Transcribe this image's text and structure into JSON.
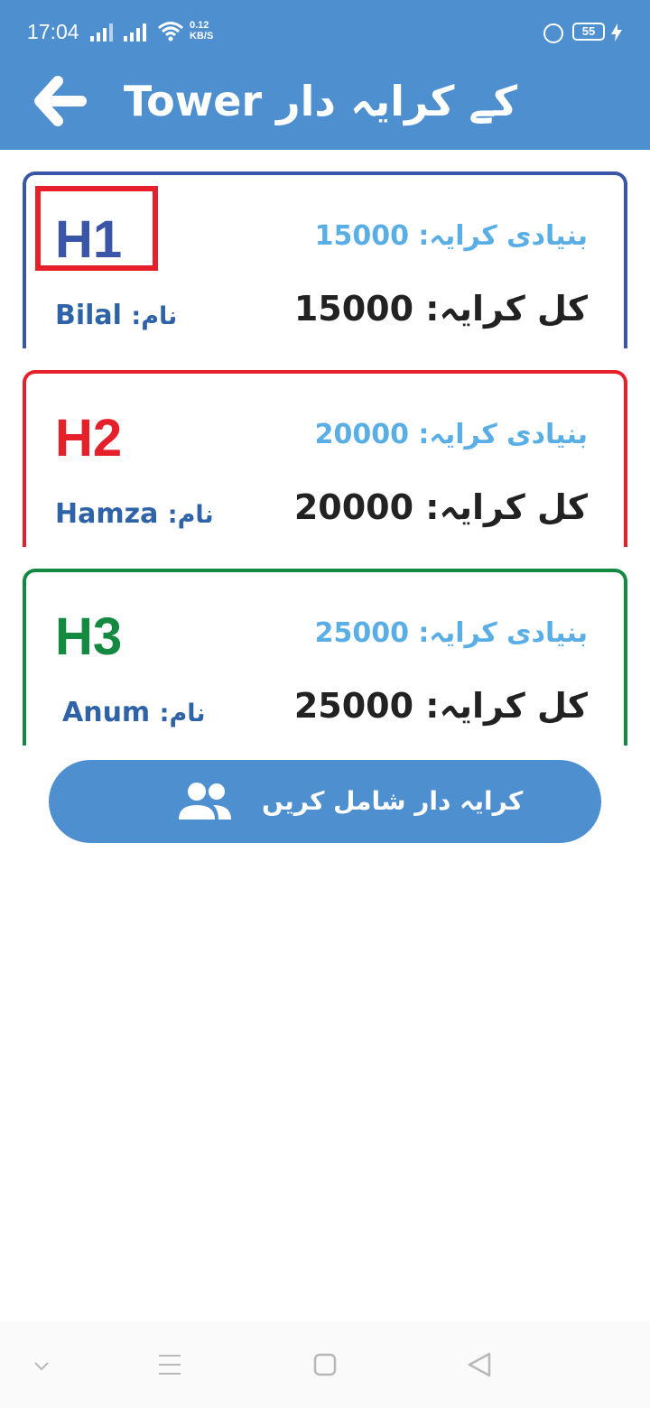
{
  "status_bar": {
    "time": "17:04",
    "net_speed_value": "0.12",
    "net_speed_unit": "KB/S",
    "battery": "55"
  },
  "header": {
    "title": "Tower کے کرایہ دار",
    "back_icon": "arrow-left-icon",
    "background_color": "#4e8fd0"
  },
  "labels": {
    "base_rent": "بنیادی کرایہ:",
    "total_rent": "کل کرایہ:",
    "name": "نام:"
  },
  "tenants": [
    {
      "code": "H1",
      "base_rent": "15000",
      "total_rent": "15000",
      "name": "Bilal",
      "color": "#3a54a8"
    },
    {
      "code": "H2",
      "base_rent": "20000",
      "total_rent": "20000",
      "name": "Hamza",
      "color": "#e6202b"
    },
    {
      "code": "H3",
      "base_rent": "25000",
      "total_rent": "25000",
      "name": "Anum",
      "color": "#138a40"
    }
  ],
  "add_button": {
    "label": "کرایہ دار شامل کریں",
    "icon": "people-icon"
  },
  "nav_bar": {
    "items": [
      "chevron-down-icon",
      "menu-icon",
      "home-square-icon",
      "back-triangle-icon"
    ]
  }
}
